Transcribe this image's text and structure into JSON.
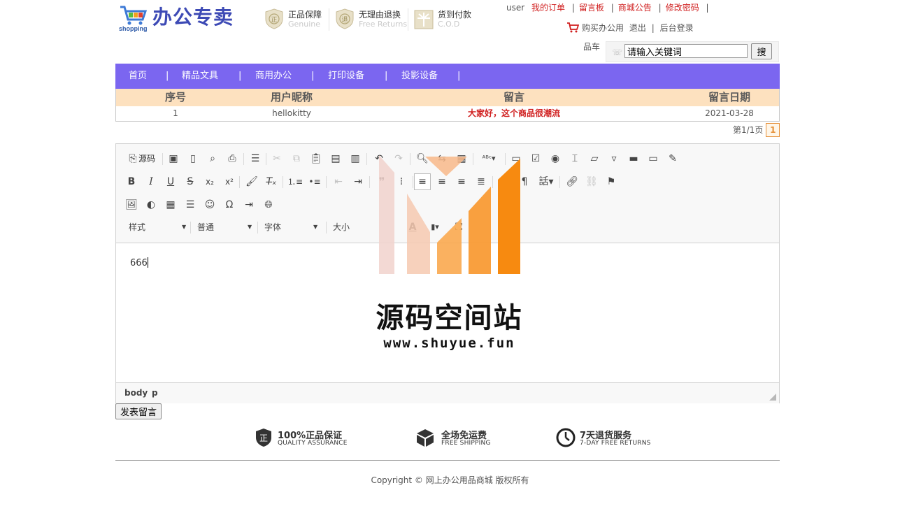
{
  "header": {
    "logo_tag": "shopping",
    "brand": "办公专卖",
    "promises": [
      {
        "title": "正品保障",
        "sub": "Genuine",
        "icon": "shield-genuine-icon",
        "glyph": "正"
      },
      {
        "title": "无理由退换",
        "sub": "Free Returns",
        "icon": "shield-return-icon",
        "glyph": "退"
      },
      {
        "title": "货到付款",
        "sub": "C.O.D",
        "icon": "cod-icon",
        "glyph": "¥"
      }
    ],
    "topnav": {
      "user": "user",
      "links": [
        "我的订单",
        "留言板",
        "商城公告",
        "修改密码"
      ]
    },
    "cart": {
      "label": "购买办公用",
      "logout": "退出",
      "admin": "后台登录"
    },
    "search": {
      "label": "品车",
      "value": "请输入关键词",
      "button": "搜"
    }
  },
  "nav": {
    "items": [
      "首页",
      "精品文具",
      "商用办公",
      "打印设备",
      "投影设备"
    ],
    "separator": "|"
  },
  "table": {
    "headers": [
      "序号",
      "用户昵称",
      "留言",
      "留言日期"
    ],
    "rows": [
      {
        "id": "1",
        "nickname": "hellokitty",
        "message": "大家好，这个商品很潮流",
        "date": "2021-03-28"
      }
    ]
  },
  "pager": {
    "text": "第1/1页",
    "current": "1"
  },
  "editor": {
    "source_label": "源码",
    "combos": {
      "style": "样式",
      "format": "普通",
      "font": "字体",
      "size": "大小"
    },
    "content": "666",
    "path": [
      "body",
      "p"
    ]
  },
  "submit": {
    "label": "发表留言"
  },
  "watermark": {
    "title": "源码空间站",
    "url": "www.shuyue.fun"
  },
  "footer": {
    "guarantees": [
      {
        "title": "100%正品保证",
        "sub": "QUALITY ASSURANCE",
        "icon": "quality-shield-icon"
      },
      {
        "title": "全场免运费",
        "sub": "FREE SHIPPING",
        "icon": "box-icon"
      },
      {
        "title": "7天退货服务",
        "sub": "7-DAY FREE RETURNS",
        "icon": "clock-icon"
      }
    ],
    "copyright": "Copyright © 网上办公用品商城 版权所有"
  },
  "colors": {
    "nav": "#7b66f0",
    "table_head": "#fde1bf",
    "link_red": "#d01f1f",
    "accent_orange": "#f7931e"
  }
}
